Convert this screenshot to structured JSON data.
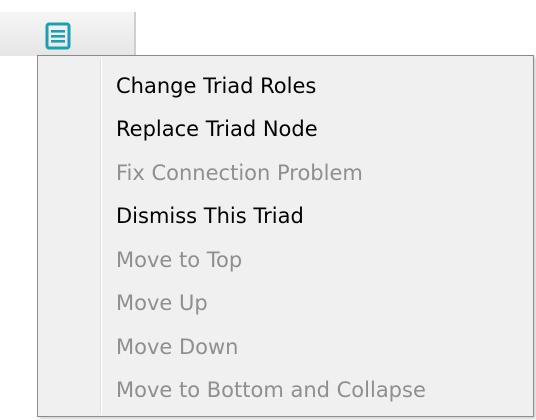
{
  "toolbar": {
    "menu_icon": "menu-lines-icon",
    "accent_color": "#1a9fb5"
  },
  "context_menu": {
    "items": [
      {
        "label": "Change Triad Roles",
        "enabled": true
      },
      {
        "label": "Replace Triad Node",
        "enabled": true
      },
      {
        "label": "Fix Connection Problem",
        "enabled": false
      },
      {
        "label": "Dismiss This Triad",
        "enabled": true
      },
      {
        "label": "Move to Top",
        "enabled": false
      },
      {
        "label": "Move Up",
        "enabled": false
      },
      {
        "label": "Move Down",
        "enabled": false
      },
      {
        "label": "Move to Bottom and Collapse",
        "enabled": false
      }
    ],
    "enabled_color": "#000000",
    "disabled_color": "#8f8f8f"
  }
}
